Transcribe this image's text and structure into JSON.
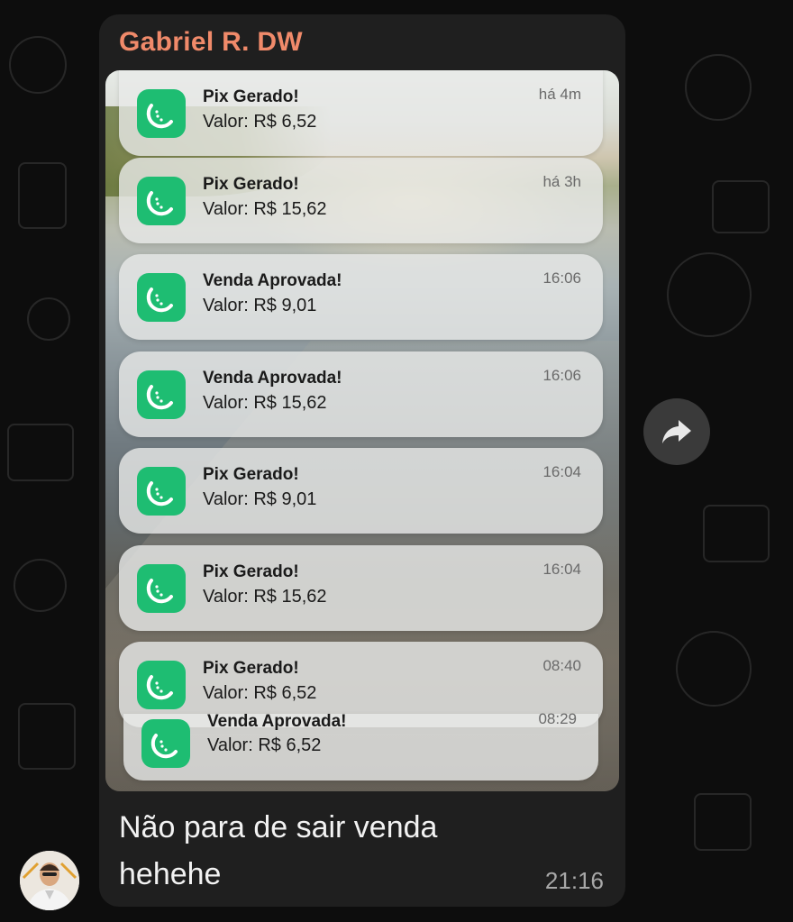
{
  "message": {
    "sender_name": "Gabriel R. DW",
    "caption": "Não para de sair venda hehehe",
    "time": "21:16"
  },
  "notifications": [
    {
      "title": "Pix Gerado!",
      "amount": "Valor: R$ 6,52",
      "time": "há 4m"
    },
    {
      "title": "Pix Gerado!",
      "amount": "Valor: R$ 15,62",
      "time": "há 3h"
    },
    {
      "title": "Venda Aprovada!",
      "amount": "Valor: R$ 9,01",
      "time": "16:06"
    },
    {
      "title": "Venda Aprovada!",
      "amount": "Valor: R$ 15,62",
      "time": "16:06"
    },
    {
      "title": "Pix Gerado!",
      "amount": "Valor: R$ 9,01",
      "time": "16:04"
    },
    {
      "title": "Pix Gerado!",
      "amount": "Valor: R$ 15,62",
      "time": "16:04"
    },
    {
      "title": "Pix Gerado!",
      "amount": "Valor: R$ 6,52",
      "time": "08:40"
    },
    {
      "title": "Venda Aprovada!",
      "amount": "Valor: R$ 6,52",
      "time": "08:29"
    }
  ],
  "icons": {
    "notification_app": "watermelon-slice-icon",
    "forward": "forward-arrow-icon",
    "avatar": "avatar"
  },
  "colors": {
    "sender_name": "#f08a6a",
    "app_icon_bg": "#1ebd72",
    "bubble_bg": "#1f1f1f"
  }
}
